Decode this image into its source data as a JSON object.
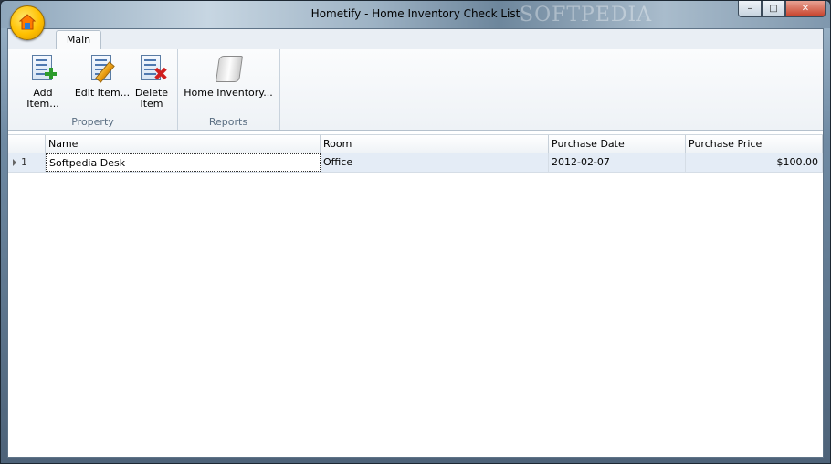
{
  "window": {
    "title": "Hometify - Home Inventory Check List",
    "watermark": "SOFTPEDIA",
    "minimize_label": "–",
    "maximize_label": "□",
    "close_label": "✕"
  },
  "tabs": [
    {
      "label": "Main"
    }
  ],
  "ribbon": {
    "groups": [
      {
        "label": "Property",
        "buttons": [
          {
            "label": "Add Item...",
            "icon": "add-document-icon"
          },
          {
            "label": "Edit Item...",
            "icon": "edit-document-icon"
          },
          {
            "label": "Delete Item",
            "icon": "delete-document-icon"
          }
        ]
      },
      {
        "label": "Reports",
        "buttons": [
          {
            "label": "Home Inventory...",
            "icon": "scroll-report-icon"
          }
        ]
      }
    ]
  },
  "grid": {
    "columns": [
      "",
      "Name",
      "Room",
      "Purchase Date",
      "Purchase Price"
    ],
    "rows": [
      {
        "row_number": "1",
        "name": "Softpedia Desk",
        "room": "Office",
        "purchase_date": "2012-02-07",
        "purchase_price": "$100.00"
      }
    ]
  }
}
